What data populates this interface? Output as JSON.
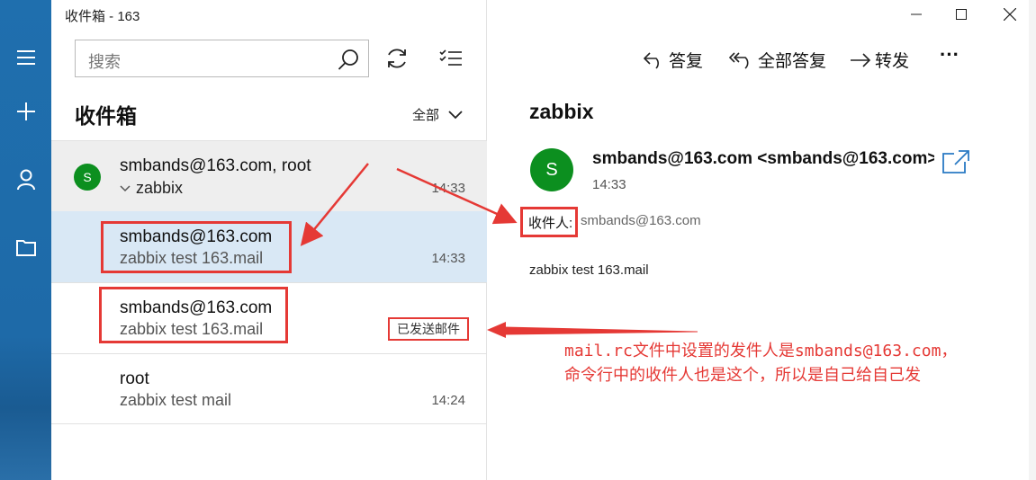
{
  "window": {
    "title": "收件箱 - 163"
  },
  "rail": {
    "items": [
      "menu-icon",
      "compose-icon",
      "account-icon",
      "folder-icon"
    ]
  },
  "search": {
    "placeholder": "搜索"
  },
  "folder": {
    "title": "收件箱",
    "filter_label": "全部"
  },
  "messages": [
    {
      "from": "smbands@163.com, root",
      "subject": "zabbix",
      "time": "14:33",
      "avatar": "S"
    },
    {
      "from": "smbands@163.com",
      "subject": "zabbix test 163.mail",
      "time": "14:33"
    },
    {
      "from": "smbands@163.com",
      "subject": "zabbix test 163.mail",
      "tag": "已发送邮件"
    },
    {
      "from": "root",
      "subject": "zabbix test mail",
      "time": "14:24"
    }
  ],
  "reading": {
    "actions": {
      "reply": "答复",
      "reply_all": "全部答复",
      "forward": "转发",
      "more": "···"
    },
    "subject": "zabbix",
    "avatar": "S",
    "sender": "smbands@163.com <smbands@163.com>",
    "time": "14:33",
    "to_label": "收件人:",
    "to_value": "smbands@163.com",
    "body": "zabbix test 163.mail"
  },
  "annotation": {
    "line1": "mail.rc文件中设置的发件人是smbands@163.com，",
    "line2": "命令行中的收件人也是这个，所以是自己给自己发"
  },
  "colors": {
    "accent": "#1e6aa8",
    "avatar": "#0c8f1f",
    "selected": "#d9e8f5",
    "annotation": "#e53935"
  }
}
